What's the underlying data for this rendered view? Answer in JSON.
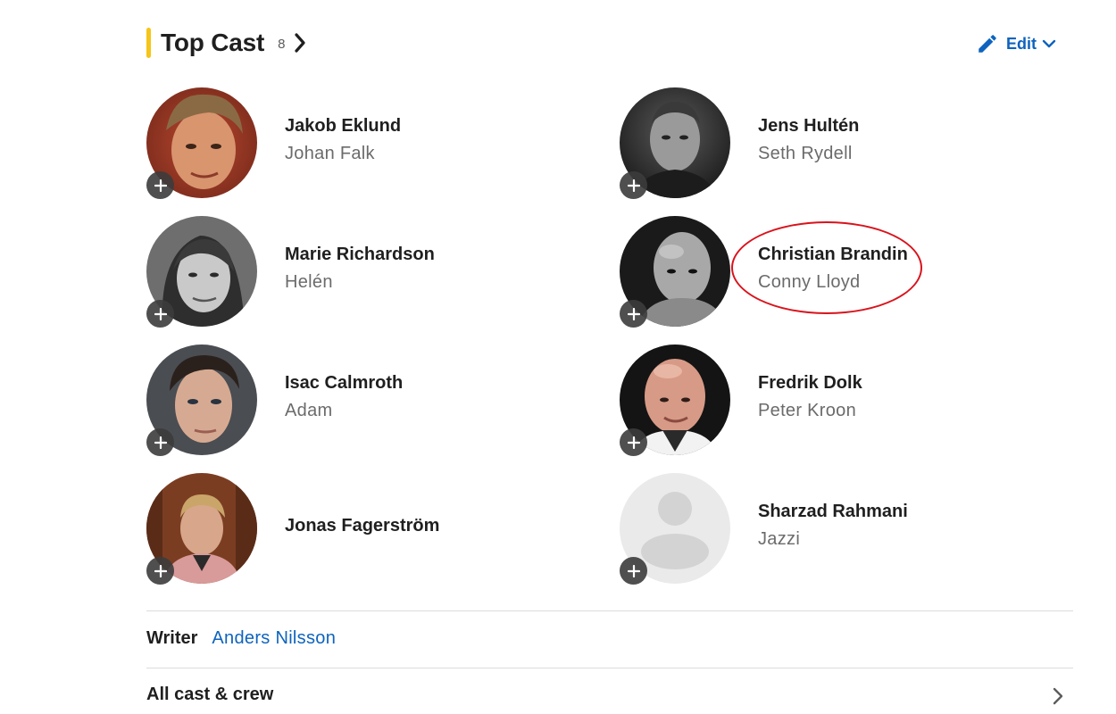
{
  "header": {
    "title": "Top Cast",
    "count": "8",
    "edit_label": "Edit",
    "accent_color": "#f5c518",
    "link_color": "#0e63be"
  },
  "cast": [
    {
      "actor": "Jakob Eklund",
      "character": "Johan Falk",
      "photo": "photo-color-blond-man"
    },
    {
      "actor": "Jens Hultén",
      "character": "Seth Rydell",
      "photo": "photo-bw-man"
    },
    {
      "actor": "Marie Richardson",
      "character": "Helén",
      "photo": "photo-bw-woman"
    },
    {
      "actor": "Christian Brandin",
      "character": "Conny Lloyd",
      "photo": "photo-bw-bald-man"
    },
    {
      "actor": "Isac Calmroth",
      "character": "Adam",
      "photo": "photo-color-young-man"
    },
    {
      "actor": "Fredrik Dolk",
      "character": "Peter Kroon",
      "photo": "photo-color-bald-man"
    },
    {
      "actor": "Jonas Fagerström",
      "character": "",
      "photo": "photo-color-man-pink-shirt"
    },
    {
      "actor": "Sharzad Rahmani",
      "character": "Jazzi",
      "photo": "placeholder-person-icon"
    }
  ],
  "credits": {
    "writer_label": "Writer",
    "writer_name": "Anders Nilsson",
    "all_cast_label": "All cast & crew"
  },
  "annotation_color": "#d9131c"
}
